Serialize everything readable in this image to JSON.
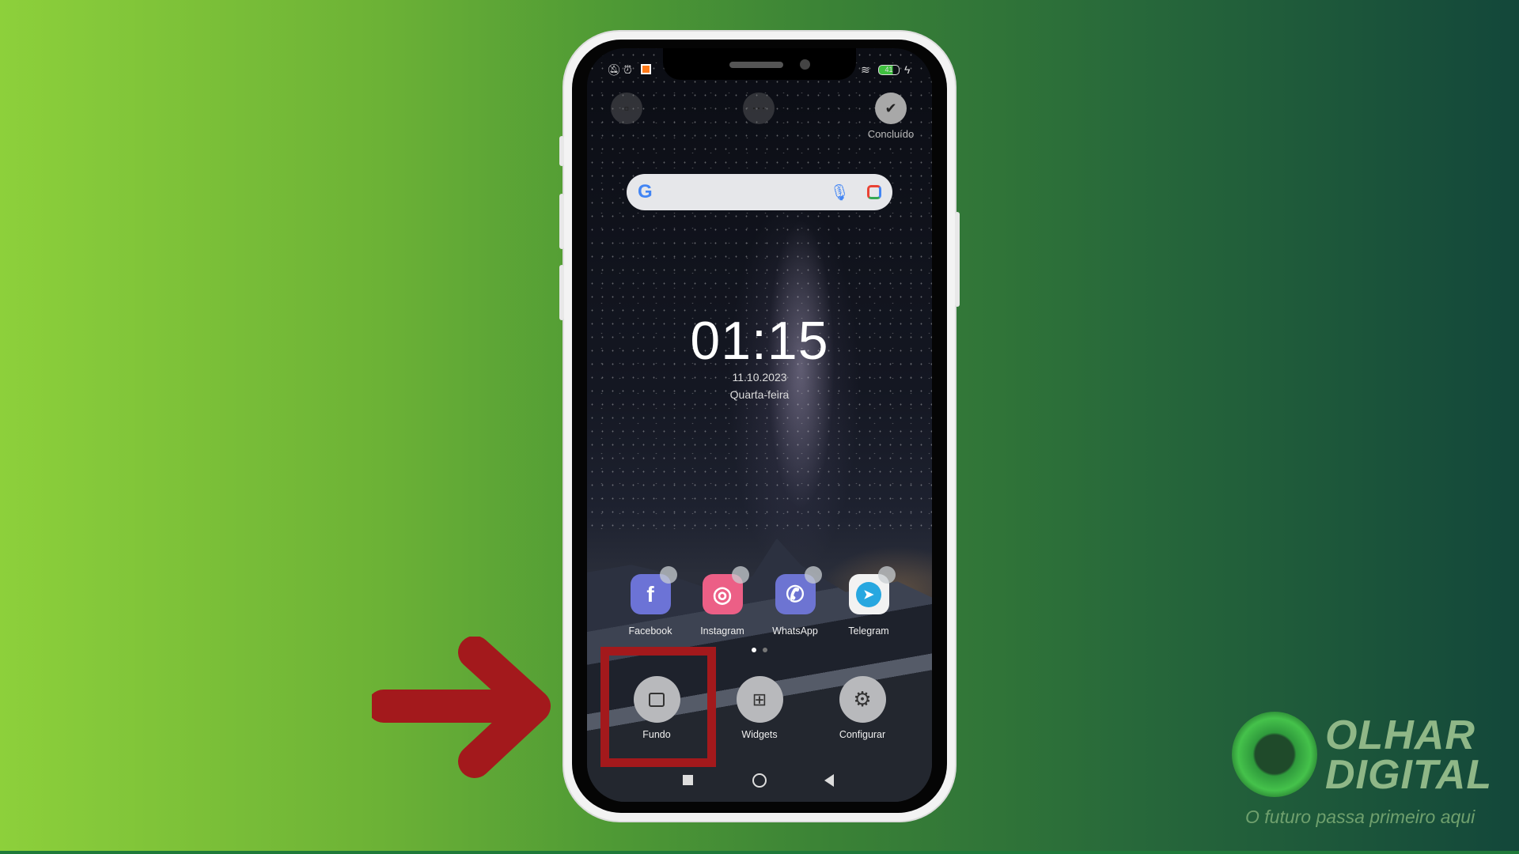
{
  "status_bar": {
    "icons": [
      "notifications-off-icon",
      "alarm-icon",
      "app-notification-icon",
      "wifi-icon",
      "battery-icon",
      "charging-icon"
    ],
    "battery": "41"
  },
  "edit_mode": {
    "buttons": [
      {
        "icon": "folder-icon",
        "label": ""
      },
      {
        "icon": "more-icon",
        "label": ""
      },
      {
        "icon": "check-icon",
        "label": "Concluído"
      }
    ]
  },
  "search": {
    "logo": "G",
    "icons": [
      "mic-icon",
      "lens-icon"
    ]
  },
  "clock": {
    "time": "01:15",
    "date": "11.10.2023",
    "weekday": "Quarta-feira"
  },
  "apps": [
    {
      "label": "Facebook",
      "glyph": "f",
      "color": "#6c73d6"
    },
    {
      "label": "Instagram",
      "glyph": "◎",
      "color": "#ec5f86"
    },
    {
      "label": "WhatsApp",
      "glyph": "✆",
      "color": "#6d74d2"
    },
    {
      "label": "Telegram",
      "glyph": "➤",
      "color": "#f2f2f2"
    }
  ],
  "page_indicator": {
    "pages": 2,
    "current": 1
  },
  "actions": [
    {
      "label": "Fundo",
      "icon": "wallpaper-icon"
    },
    {
      "label": "Widgets",
      "icon": "widgets-icon"
    },
    {
      "label": "Configurar",
      "icon": "settings-gear-icon"
    }
  ],
  "highlight": {
    "target": "Fundo",
    "color": "#a3191c"
  },
  "nav": [
    "recents-icon",
    "home-icon",
    "back-icon"
  ],
  "watermark": {
    "brand_line1": "OLHAR",
    "brand_line2": "DIGITAL",
    "tagline": "O futuro passa primeiro aqui"
  }
}
